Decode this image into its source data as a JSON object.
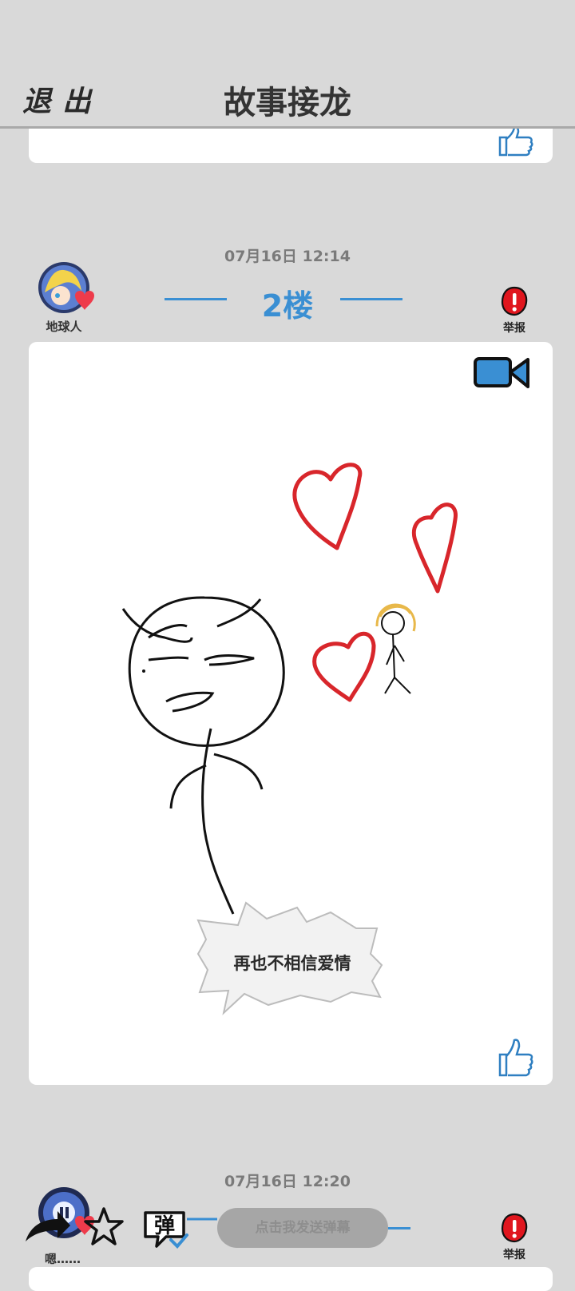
{
  "header": {
    "exit_label": "退出",
    "title": "故事接龙"
  },
  "posts": [
    {
      "timestamp": "07月16日  12:14",
      "floor": "2楼",
      "username": "地球人",
      "report_label": "举报",
      "caption": "再也不相信爱情"
    },
    {
      "timestamp": "07月16日  12:20",
      "report_label": "举报",
      "reply_preview": "嗯……"
    }
  ],
  "toolbar": {
    "danmaku_icon_text": "弹",
    "danmaku_placeholder": "点击我发送弹幕"
  },
  "colors": {
    "accent_blue": "#3a8fd3",
    "report_red": "#e0161e",
    "heart_red": "#d8262b",
    "background": "#d9d9d9"
  },
  "icons": [
    "thumbs-up-icon",
    "video-camera-icon",
    "report-icon",
    "share-arrow-icon",
    "star-icon",
    "danmaku-icon",
    "heart-badge-icon"
  ]
}
